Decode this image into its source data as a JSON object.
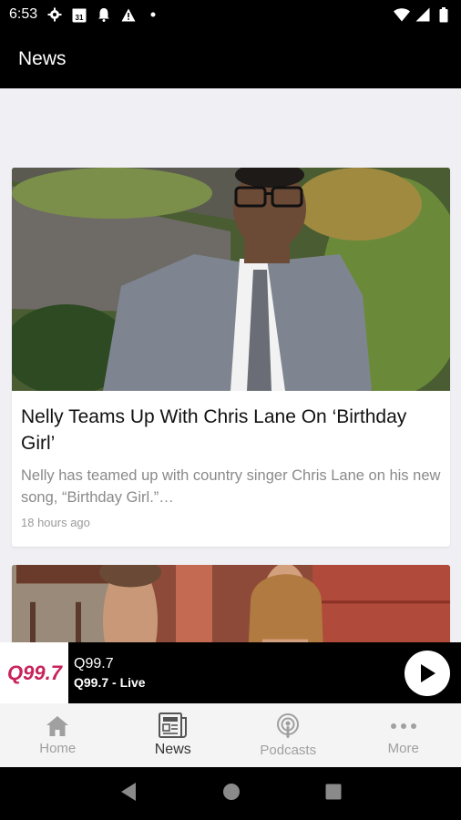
{
  "status_bar": {
    "time": "6:53",
    "calendar_day": "31",
    "left_icons": [
      "gear-icon",
      "calendar-icon",
      "bell-icon",
      "warning-icon",
      "dot-icon"
    ],
    "right_icons": [
      "wifi-icon",
      "signal-icon",
      "battery-icon"
    ]
  },
  "app_bar": {
    "title": "News"
  },
  "articles": [
    {
      "title": "Nelly Teams Up With Chris Lane On ‘Birthday Girl’",
      "excerpt": "Nelly has teamed up with country singer Chris Lane on his new song, “Birthday Girl.”…",
      "time": "18 hours ago"
    }
  ],
  "player": {
    "logo_text": "Q99.7",
    "station": "Q99.7",
    "subtitle": "Q99.7 - Live",
    "brand_color": "#c8235a"
  },
  "bottom_nav": {
    "items": [
      {
        "label": "Home",
        "icon": "home-icon",
        "active": false
      },
      {
        "label": "News",
        "icon": "news-icon",
        "active": true
      },
      {
        "label": "Podcasts",
        "icon": "podcast-icon",
        "active": false
      },
      {
        "label": "More",
        "icon": "more-icon",
        "active": false
      }
    ]
  },
  "system_nav": [
    "back-icon",
    "home-circle-icon",
    "recents-icon"
  ]
}
